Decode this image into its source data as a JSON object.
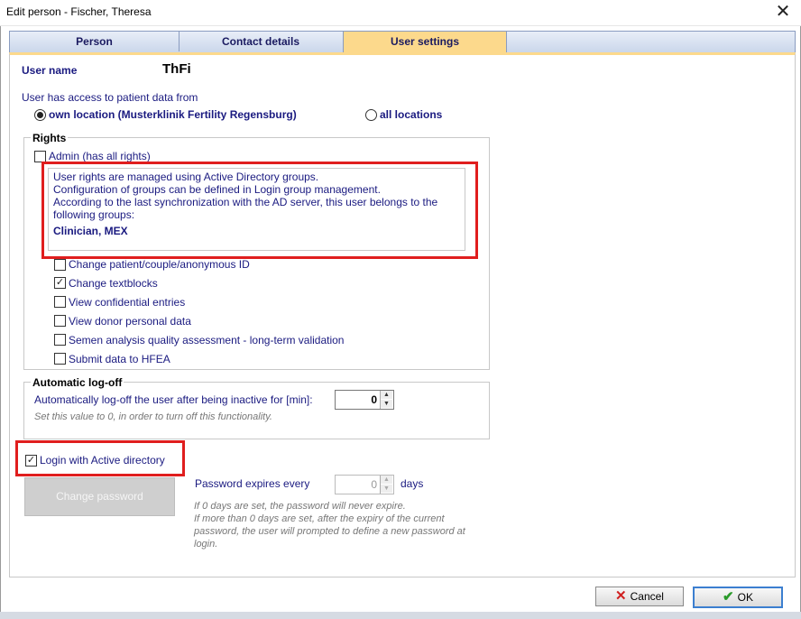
{
  "window": {
    "title": "Edit person - Fischer, Theresa"
  },
  "tabs": [
    {
      "label": "Person"
    },
    {
      "label": "Contact details"
    },
    {
      "label": "User settings"
    }
  ],
  "user": {
    "label": "User name",
    "value": "ThFi"
  },
  "access": {
    "label": "User has access to patient data from",
    "own_location": "own location (Musterklinik Fertility Regensburg)",
    "all_locations": "all locations"
  },
  "rights": {
    "title": "Rights",
    "admin": "Admin (has all rights)",
    "info": {
      "line1": "User rights are managed using Active Directory groups.",
      "line2": "Configuration of groups can be defined in Login group management.",
      "line3": "According to the last synchronization with the AD server, this user belongs to the",
      "line4": "following groups:",
      "groups": "Clinician, MEX"
    },
    "items": [
      {
        "label": "Change patient/couple/anonymous ID",
        "checked": false
      },
      {
        "label": "Change textblocks",
        "checked": true
      },
      {
        "label": "View confidential entries",
        "checked": false
      },
      {
        "label": "View donor personal data",
        "checked": false
      },
      {
        "label": "Semen analysis quality assessment -  long-term validation",
        "checked": false
      },
      {
        "label": "Submit data to HFEA",
        "checked": false
      }
    ]
  },
  "logoff": {
    "title": "Automatic log-off",
    "label": "Automatically log-off the user after being inactive for [min]:",
    "value": "0",
    "hint": "Set this value to 0, in order to turn off this functionality."
  },
  "login": {
    "active_directory": "Login with Active directory"
  },
  "password": {
    "change_label": "Change password",
    "expires_label": "Password expires every",
    "expires_value": "0",
    "days_label": "days",
    "hint1": "If 0 days are set, the password will never expire.",
    "hint2": "If more than 0 days are set, after the expiry of the current",
    "hint3": "password, the user will prompted to define a new password at",
    "hint4": "login."
  },
  "footer": {
    "cancel_label": "Cancel",
    "ok_label": "OK"
  },
  "colors": {
    "tab_active": "#fcd98c",
    "highlight": "#e01e1e",
    "text": "#1a1a80"
  },
  "icons": [
    "close-icon",
    "cancel-x-icon",
    "ok-check-icon",
    "spin-up-icon",
    "spin-down-icon"
  ]
}
